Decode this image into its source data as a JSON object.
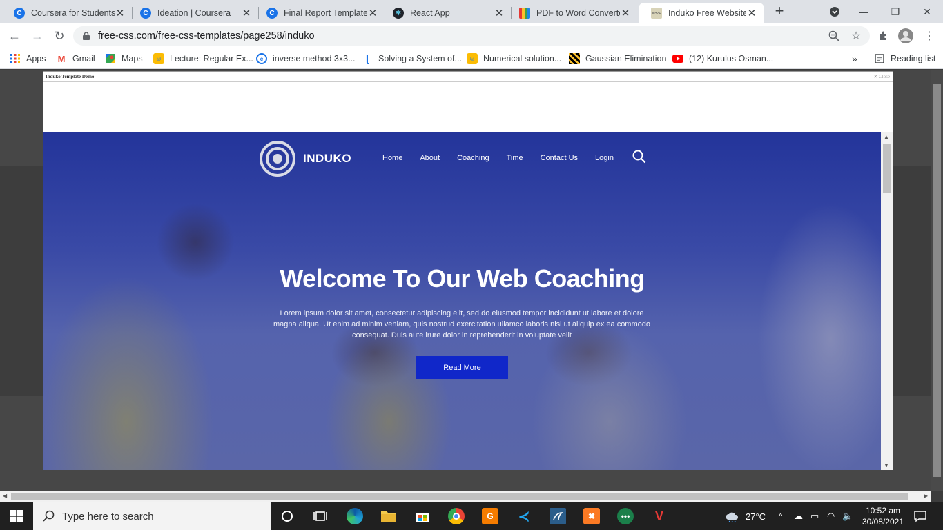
{
  "browser": {
    "tabs": [
      {
        "title": "Coursera for Students",
        "favicon": "coursera-icon",
        "active": false
      },
      {
        "title": "Ideation | Coursera",
        "favicon": "coursera-icon",
        "active": false
      },
      {
        "title": "Final Report Template",
        "favicon": "coursera-icon",
        "active": false
      },
      {
        "title": "React App",
        "favicon": "react-icon",
        "active": false
      },
      {
        "title": "PDF to Word Converte",
        "favicon": "pdf-converter-icon",
        "active": false
      },
      {
        "title": "Induko Free Website T",
        "favicon": "css-icon",
        "active": true
      }
    ],
    "url": "free-css.com/free-css-templates/page258/induko",
    "bookmarks": [
      {
        "label": "Apps",
        "icon": "apps-grid-icon"
      },
      {
        "label": "Gmail",
        "icon": "gmail-icon"
      },
      {
        "label": "Maps",
        "icon": "maps-icon"
      },
      {
        "label": "Lecture: Regular Ex...",
        "icon": "lecture-icon"
      },
      {
        "label": "inverse method 3x3...",
        "icon": "inverse-icon"
      },
      {
        "label": "Solving a System of...",
        "icon": "solving-icon"
      },
      {
        "label": "Numerical solution...",
        "icon": "numerical-icon"
      },
      {
        "label": "Gaussian Elimination",
        "icon": "gaussian-icon"
      },
      {
        "label": "(12) Kurulus Osman...",
        "icon": "youtube-icon"
      }
    ],
    "overflow": "»",
    "reading_list": "Reading list"
  },
  "demo": {
    "header_label": "Induko Template Demo",
    "close_label": "Close"
  },
  "site": {
    "logo_text": "INDUKO",
    "menu": [
      "Home",
      "About",
      "Coaching",
      "Time",
      "Contact Us",
      "Login"
    ],
    "hero_title": "Welcome To Our Web Coaching",
    "hero_text": "Lorem ipsum dolor sit amet, consectetur adipiscing elit, sed do eiusmod tempor incididunt ut labore et dolore magna aliqua. Ut enim ad minim veniam, quis nostrud exercitation ullamco laboris nisi ut aliquip ex ea commodo consequat. Duis aute irure dolor in reprehenderit in voluptate velit",
    "cta_label": "Read More"
  },
  "taskbar": {
    "search_placeholder": "Type here to search",
    "temperature": "27°C",
    "time": "10:52 am",
    "date": "30/08/2021"
  },
  "colors": {
    "hero_blue": "#23349a",
    "cta_blue": "#1027c9"
  }
}
